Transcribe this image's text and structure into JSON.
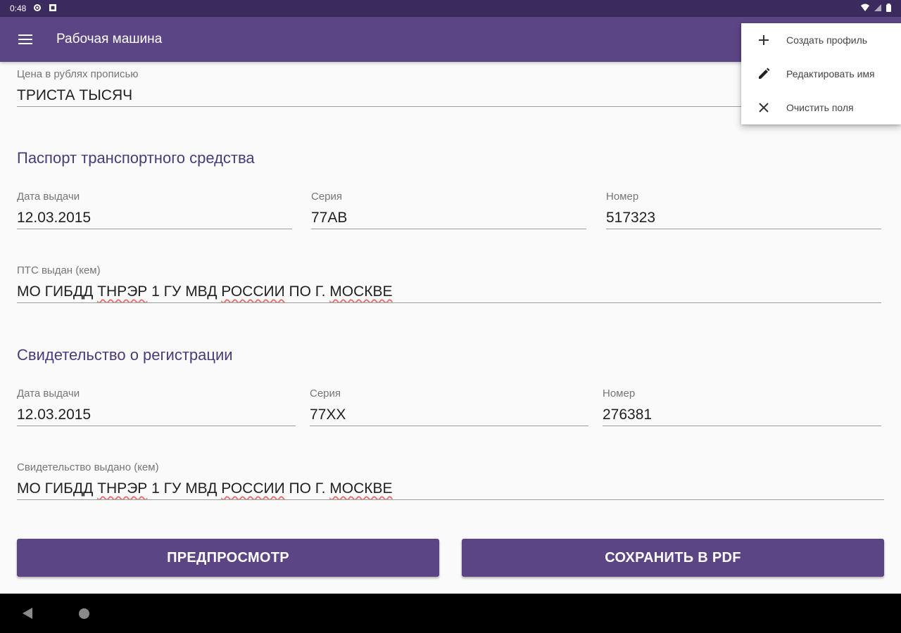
{
  "status_bar": {
    "time": "0:48"
  },
  "app_bar": {
    "title": "Рабочая машина"
  },
  "menu": {
    "items": [
      {
        "icon": "plus-icon",
        "label": "Создать профиль"
      },
      {
        "icon": "pencil-icon",
        "label": "Редактировать имя"
      },
      {
        "icon": "close-icon",
        "label": "Очистить поля"
      }
    ]
  },
  "price_words": {
    "label": "Цена в рублях прописью",
    "value": "ТРИСТА ТЫСЯЧ"
  },
  "pts": {
    "title": "Паспорт транспортного средства",
    "date": {
      "label": "Дата выдачи",
      "value": "12.03.2015"
    },
    "series": {
      "label": "Серия",
      "value": "77АВ"
    },
    "number": {
      "label": "Номер",
      "value": "517323"
    },
    "issued_by": {
      "label": "ПТС выдан (кем)",
      "parts": [
        "МО ГИБДД ",
        "ТНРЭР",
        " 1 ГУ МВД ",
        "РОССИИ",
        " ПО Г. ",
        "МОСКВЕ"
      ]
    }
  },
  "registration": {
    "title": "Свидетельство о регистрации",
    "date": {
      "label": "Дата выдачи",
      "value": "12.03.2015"
    },
    "series": {
      "label": "Серия",
      "value": "77ХХ"
    },
    "number": {
      "label": "Номер",
      "value": "276381"
    },
    "issued_by": {
      "label": "Свидетельство выдано (кем)",
      "parts": [
        "МО ГИБДД ",
        "ТНРЭР",
        " 1 ГУ МВД ",
        "РОССИИ",
        " ПО Г. ",
        "МОСКВЕ"
      ]
    }
  },
  "buttons": {
    "preview": "ПРЕДПРОСМОТР",
    "save_pdf": "СОХРАНИТЬ В PDF"
  },
  "colors": {
    "primary": "#5c4585",
    "primary_dark": "#3a2a5e",
    "accent_text": "#4a3a7a"
  }
}
